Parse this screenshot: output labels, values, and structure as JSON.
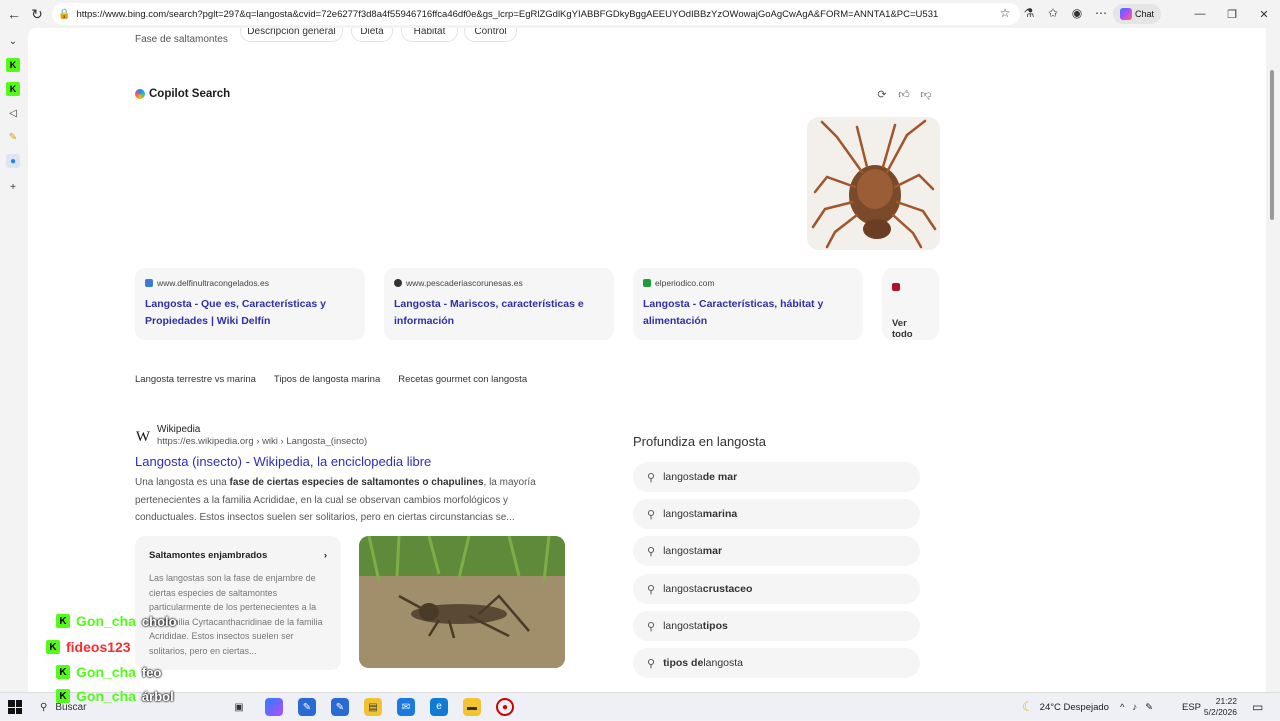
{
  "browser": {
    "url": "https://www.bing.com/search?pglt=297&q=langosta&cvid=72e6277f3d8a4f55946716ffca46df0e&gs_lcrp=EgRlZGdlKgYIABBFGDkyBggAEEUYOdIBBzYzOWowajGoAgCwAgA&FORM=ANNTA1&PC=U531",
    "chat_label": "Chat"
  },
  "page": {
    "subtitle": "Fase de saltamontes",
    "tabs": [
      "Descripción general",
      "Dieta",
      "Hábitat",
      "Control"
    ]
  },
  "copilot": {
    "title": "Copilot Search",
    "image_alt": "lobster-photo",
    "sources": [
      {
        "domain": "www.delfinultracongelados.es",
        "title": "Langosta - Que es, Características y Propiedades | Wiki Delfín",
        "favicon_color": "#3a7bd5"
      },
      {
        "domain": "www.pescaderiascorunesas.es",
        "title": "Langosta - Mariscos, características e información",
        "favicon_color": "#333333"
      },
      {
        "domain": "elperiodico.com",
        "title": "Langosta - Características, hábitat y alimentación",
        "favicon_color": "#1a9e3a"
      }
    ],
    "see_all": "Ver todo",
    "related_chips": [
      "Langosta terrestre vs marina",
      "Tipos de langosta marina",
      "Recetas gourmet con langosta"
    ]
  },
  "result": {
    "site_name": "Wikipedia",
    "site_url": "https://es.wikipedia.org › wiki › Langosta_(insecto)",
    "title": "Langosta (insecto) - Wikipedia, la enciclopedia libre",
    "snippet_pre": "Una langosta es una ",
    "snippet_bold": "fase de ciertas especies de saltamontes o chapulines",
    "snippet_post": ", la mayoría pertenecientes a la familia Acrididae, en la cual se observan cambios morfológicos y conductuales. Estos insectos suelen ser solitarios, pero en ciertas circunstancias se...",
    "card_title": "Saltamontes enjambrados",
    "card_text": "Las langostas son la fase de enjambre de ciertas especies de saltamontes particularmente de los pertenecientes a la subfamilia Cyrtacanthacridinae de la familia Acrididae. Estos insectos suelen ser solitarios, pero en ciertas..."
  },
  "related": {
    "title": "Profundiza en langosta",
    "items": [
      {
        "prefix": "langosta ",
        "bold": "de mar"
      },
      {
        "prefix": "langosta ",
        "bold": "marina"
      },
      {
        "prefix": "langosta ",
        "bold": "mar"
      },
      {
        "prefix": "langosta ",
        "bold": "crustaceo"
      },
      {
        "prefix": "langosta ",
        "bold": "tipos"
      },
      {
        "prefix": "",
        "bold": "tipos de",
        "suffix": " langosta"
      }
    ]
  },
  "chat_overlay": [
    {
      "user": "Gon_cha",
      "user_color": "#53fc18",
      "message": "cholo"
    },
    {
      "user": "fideos123",
      "user_color": "#ff2a2a",
      "message": ""
    },
    {
      "user": "Gon_cha",
      "user_color": "#53fc18",
      "message": "feo"
    },
    {
      "user": "Gon_cha",
      "user_color": "#53fc18",
      "message": "árbol"
    }
  ],
  "taskbar": {
    "search_label": "Buscar",
    "weather": "24°C  Despejado",
    "language": "ESP",
    "time": "21:22",
    "date": "5/2/2026"
  },
  "colors": {
    "link": "#2d2dbf",
    "kick_green": "#53fc18"
  }
}
